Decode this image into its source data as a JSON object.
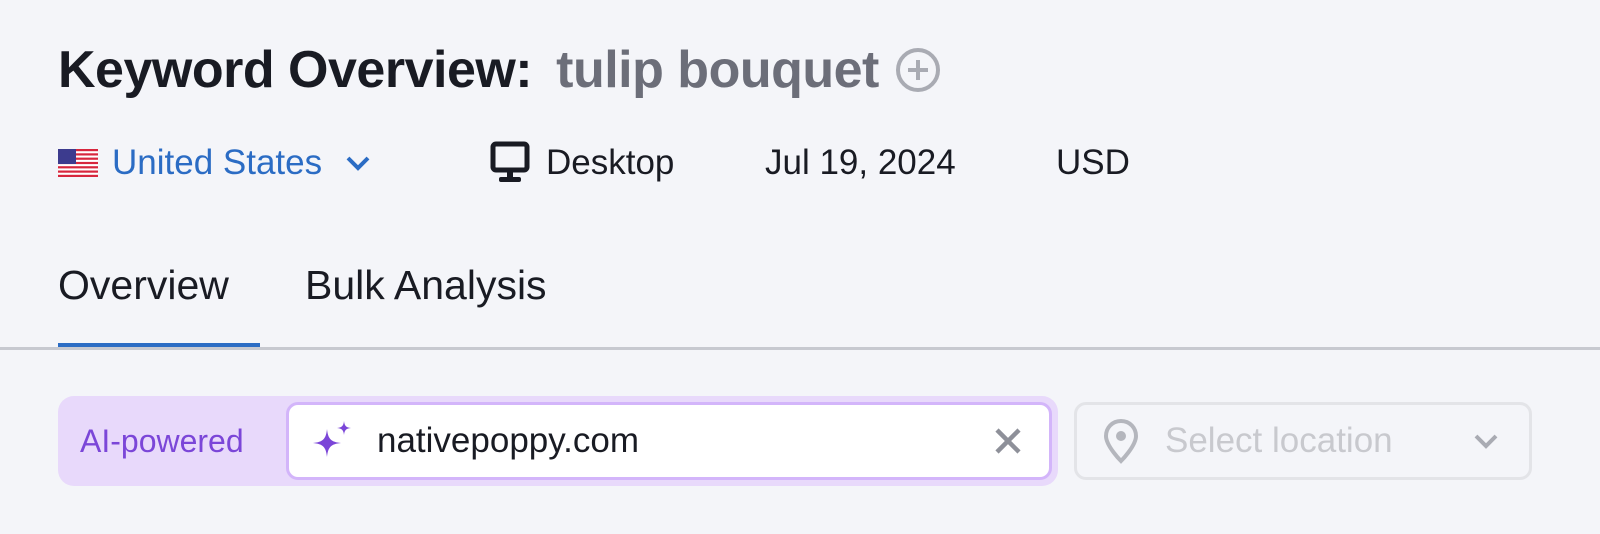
{
  "header": {
    "title_prefix": "Keyword Overview:",
    "keyword": "tulip bouquet",
    "add_icon": "plus-circle-icon"
  },
  "meta": {
    "database": "United States",
    "database_icon": "us-flag-icon",
    "device": "Desktop",
    "device_icon": "desktop-monitor-icon",
    "date": "Jul 19, 2024",
    "currency": "USD"
  },
  "tabs": [
    {
      "label": "Overview",
      "active": true
    },
    {
      "label": "Bulk Analysis",
      "active": false
    }
  ],
  "ai_search": {
    "badge": "AI-powered",
    "value": "nativepoppy.com",
    "icon": "sparkle-icon",
    "clear_icon": "close-icon"
  },
  "location": {
    "placeholder": "Select location",
    "icon": "location-pin-icon"
  },
  "colors": {
    "accent": "#2b6cc4",
    "ai_purple": "#7b46d8",
    "ai_bg": "#e8d9fb"
  }
}
